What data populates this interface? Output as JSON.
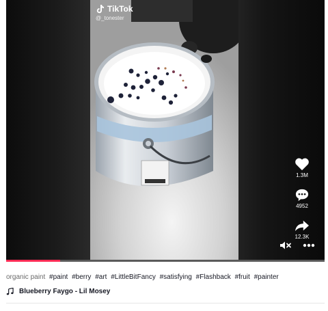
{
  "overlay": {
    "brand": "TikTok",
    "username": "@_tonester"
  },
  "actions": {
    "likes": "1.3M",
    "comments": "4952",
    "shares": "12.3K"
  },
  "icons": {
    "like": "heart-icon",
    "comment": "comment-bubble-icon",
    "share": "share-arrow-icon",
    "mute": "speaker-muted-icon",
    "more": "more-dots-icon",
    "music": "music-note-icon"
  },
  "progress": {
    "fraction": 0.17
  },
  "caption": {
    "text": "organic paint",
    "hashtags": [
      "#paint",
      "#berry",
      "#art",
      "#LittleBitFancy",
      "#satisfying",
      "#Flashback",
      "#fruit",
      "#painter"
    ]
  },
  "music": {
    "title": "Blueberry Faygo - Lil Mosey"
  },
  "colors": {
    "accent": "#fe2c55",
    "player_bg": "#121212"
  }
}
